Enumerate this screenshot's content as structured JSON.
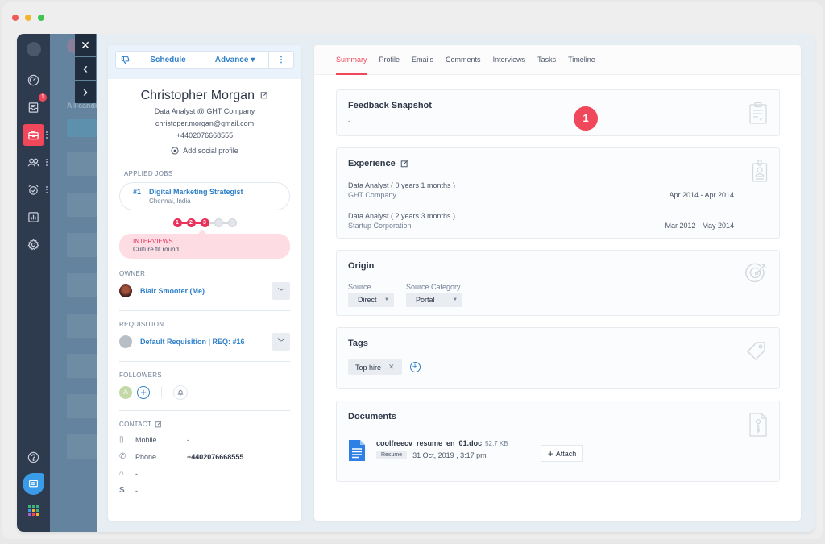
{
  "window": {
    "traffic_lights": [
      "#ed5b5b",
      "#f2b532",
      "#3fc54f"
    ]
  },
  "nav": {
    "items": [
      {
        "icon": "dashboard-gauge-icon",
        "label": "Dashboard"
      },
      {
        "icon": "inbox-icon",
        "label": "Inbox",
        "badge": "1"
      },
      {
        "icon": "briefcase-icon",
        "label": "Jobs",
        "active": true
      },
      {
        "icon": "candidates-icon",
        "label": "Candidates"
      },
      {
        "icon": "alarm-clock-icon",
        "label": "Tasks"
      },
      {
        "icon": "reports-icon",
        "label": "Reports"
      },
      {
        "icon": "gear-icon",
        "label": "Settings"
      }
    ],
    "help_label": "?",
    "accent": "#f0475a"
  },
  "overlay": {
    "partial_text": "All candi"
  },
  "pager": {
    "close": "✕",
    "prev": "‹",
    "next": "›"
  },
  "toolbar": {
    "thumb_icon": "thumbs-down-icon",
    "schedule_label": "Schedule",
    "advance_label": "Advance ▾",
    "more_label": "⋮"
  },
  "candidate": {
    "name": "Christopher Morgan",
    "title": "Data Analyst @ GHT Company",
    "email": "christoper.morgan@gmail.com",
    "phone": "+4402076668555",
    "add_social_label": "Add social profile"
  },
  "applied_jobs": {
    "label": "APPLIED JOBS",
    "jobs": [
      {
        "number": "#1",
        "title": "Digital Marketing Strategist",
        "location": "Chennai, India"
      }
    ],
    "stages": [
      {
        "n": "1",
        "done": true
      },
      {
        "n": "2",
        "done": true
      },
      {
        "n": "3",
        "done": true
      },
      {
        "n": "",
        "done": false
      },
      {
        "n": "",
        "done": false
      }
    ],
    "status_title": "INTERVIEWS",
    "status_sub": "Culture fit round"
  },
  "owner": {
    "label": "OWNER",
    "name": "Blair Smooter (Me)"
  },
  "requisition": {
    "label": "REQUISITION",
    "name": "Default Requisition | REQ: #16"
  },
  "followers": {
    "label": "FOLLOWERS",
    "avatar_initial": "A"
  },
  "contact": {
    "label": "CONTACT",
    "rows": [
      {
        "icon": "mobile-icon",
        "label": "Mobile",
        "value": "-"
      },
      {
        "icon": "phone-icon",
        "label": "Phone",
        "value": "+4402076668555"
      },
      {
        "icon": "home-icon",
        "label": "",
        "value": "-"
      },
      {
        "icon": "skype-icon",
        "label": "",
        "value": "-"
      }
    ]
  },
  "tabs": [
    {
      "label": "Summary",
      "active": true
    },
    {
      "label": "Profile"
    },
    {
      "label": "Emails"
    },
    {
      "label": "Comments"
    },
    {
      "label": "Interviews"
    },
    {
      "label": "Tasks"
    },
    {
      "label": "Timeline"
    }
  ],
  "feedback": {
    "title": "Feedback Snapshot",
    "value": "-",
    "badge": "1"
  },
  "experience": {
    "title": "Experience",
    "items": [
      {
        "role": "Data Analyst ( 0 years 1 months )",
        "company": "GHT Company",
        "dates": "Apr 2014 - Apr 2014"
      },
      {
        "role": "Data Analyst ( 2 years 3 months )",
        "company": "Startup Corporation",
        "dates": "Mar 2012 - May 2014"
      }
    ]
  },
  "origin": {
    "title": "Origin",
    "source_label": "Source",
    "source_value": "Direct",
    "category_label": "Source Category",
    "category_value": "Portal"
  },
  "tags": {
    "title": "Tags",
    "items": [
      "Top hire"
    ]
  },
  "documents": {
    "title": "Documents",
    "files": [
      {
        "name": "coolfreecv_resume_en_01.doc",
        "size": "52.7 KB",
        "tag": "Resume",
        "date": "31 Oct, 2019 , 3:17 pm"
      }
    ],
    "attach_label": "Attach"
  }
}
